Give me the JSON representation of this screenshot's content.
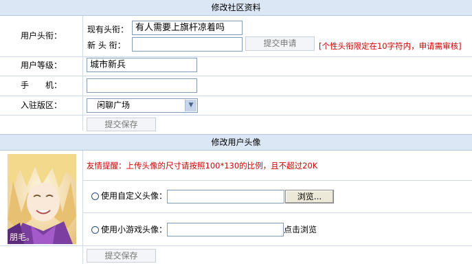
{
  "profile_section": {
    "title": "修改社区资料",
    "title_rows": {
      "label": "用户头衔：",
      "current_label": "现有头衔：",
      "current_value": "有人需要上旗杆凉着吗",
      "new_label": "新 头 衔：",
      "new_value": "",
      "submit_request_label": "提交申请",
      "note": "[个性头衔限定在10字符内，申请需审核]"
    },
    "level": {
      "label": "用户等级：",
      "value": "城市新兵"
    },
    "phone": {
      "label": "手　　机：",
      "value": ""
    },
    "board": {
      "label": "入驻版区：",
      "selected": "闲聊广场"
    },
    "save_label": "提交保存"
  },
  "avatar_section": {
    "title": "修改用户头像",
    "avatar_caption": "朋毛。",
    "reminder": "友情提醒：上传头像的尺寸请按照100*130的比例，且不超过20K",
    "custom": {
      "label": "使用自定义头像：",
      "value": "",
      "browse_label": "浏览..."
    },
    "game": {
      "label": "使用小游戏头像：",
      "value": "",
      "hint": "点击浏览"
    },
    "save_label": "提交保存"
  },
  "colors": {
    "header_bg": "#dbe7f4",
    "grid_line": "#cdd9e6",
    "note_red": "#d00000"
  }
}
